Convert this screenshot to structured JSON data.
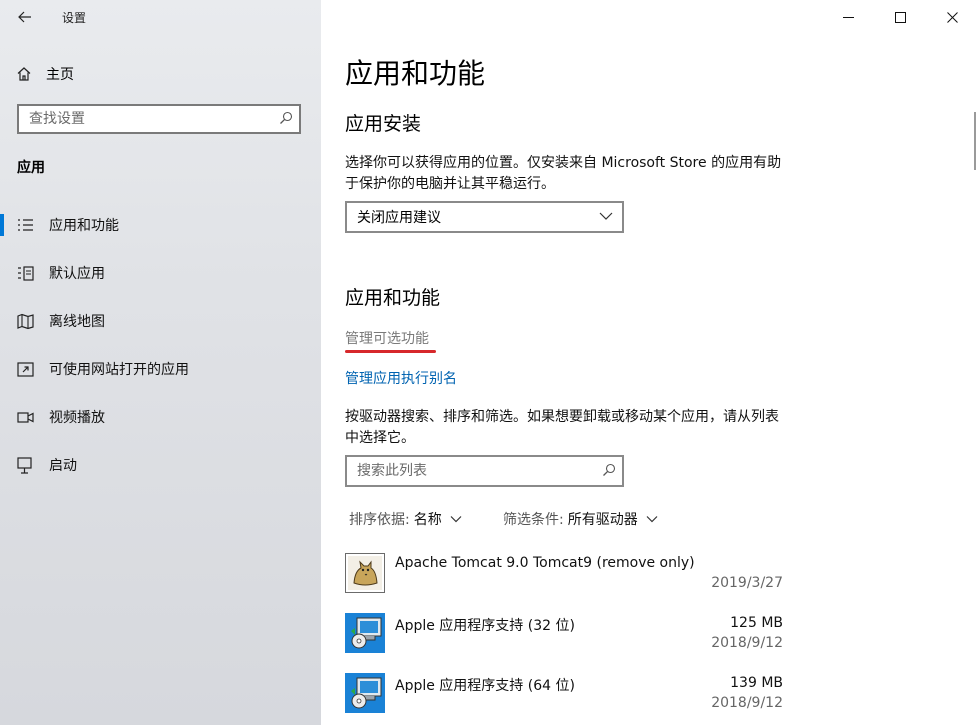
{
  "window": {
    "title": "设置"
  },
  "sidebar": {
    "home_label": "主页",
    "search_placeholder": "查找设置",
    "section_title": "应用",
    "items": [
      {
        "label": "应用和功能",
        "icon": "list-icon",
        "selected": true
      },
      {
        "label": "默认应用",
        "icon": "default-apps-icon",
        "selected": false
      },
      {
        "label": "离线地图",
        "icon": "map-icon",
        "selected": false
      },
      {
        "label": "可使用网站打开的应用",
        "icon": "open-website-icon",
        "selected": false
      },
      {
        "label": "视频播放",
        "icon": "video-icon",
        "selected": false
      },
      {
        "label": "启动",
        "icon": "startup-icon",
        "selected": false
      }
    ]
  },
  "main": {
    "page_title": "应用和功能",
    "install_heading": "应用安装",
    "install_description": "选择你可以获得应用的位置。仅安装来自 Microsoft Store 的应用有助于保护你的电脑并让其平稳运行。",
    "install_dropdown_value": "关闭应用建议",
    "features_heading": "应用和功能",
    "manage_optional_link": "管理可选功能",
    "manage_alias_link": "管理应用执行别名",
    "search_description": "按驱动器搜索、排序和筛选。如果想要卸载或移动某个应用，请从列表中选择它。",
    "list_search_placeholder": "搜索此列表",
    "sort_label": "排序依据:",
    "sort_value": "名称",
    "filter_label": "筛选条件:",
    "filter_value": "所有驱动器",
    "apps": [
      {
        "name": "Apache Tomcat 9.0 Tomcat9 (remove only)",
        "size": "",
        "date": "2019/3/27",
        "icon": "tomcat-icon"
      },
      {
        "name": "Apple 应用程序支持 (32 位)",
        "size": "125 MB",
        "date": "2018/9/12",
        "icon": "installer-icon"
      },
      {
        "name": "Apple 应用程序支持 (64 位)",
        "size": "139 MB",
        "date": "2018/9/12",
        "icon": "installer-icon"
      }
    ]
  },
  "colors": {
    "accent": "#0078d7",
    "link": "#0063b1",
    "highlight_underline": "#d7282b"
  }
}
